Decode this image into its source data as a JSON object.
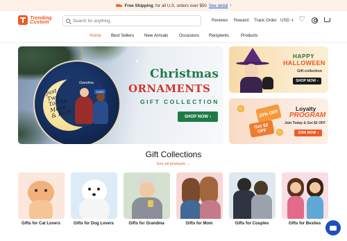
{
  "announcement": {
    "bold": "Free Shipping",
    "text": "for all U.S. orders over $50",
    "link": "See detail",
    "arrow": "›"
  },
  "header": {
    "logo_line1": "Trending",
    "logo_line2": "Custom",
    "search_placeholder": "Search for anything",
    "links": [
      "Reviews",
      "Reward",
      "Track Order"
    ],
    "currency": "USD",
    "currency_caret": "▾"
  },
  "nav": {
    "items": [
      "Home",
      "Best Sellers",
      "New Arrivals",
      "Occasions",
      "Recipients",
      "Products"
    ],
    "active": "Home"
  },
  "hero": {
    "title1": "Christmas",
    "title2": "ORNAMENTS",
    "subtitle": "GIFT COLLECTION",
    "button": "SHOP NOW",
    "button_arrow": "›",
    "ornament_text_line1": "Just",
    "ornament_text_line2": "Two",
    "ornament_text_line3": "To The",
    "ornament_text_line4": "Moon",
    "ornament_text_line5": "& Back",
    "ornament_name1": "Grandma",
    "ornament_name2": "Luna"
  },
  "promo_halloween": {
    "line1": "HAPPY",
    "line2": "HALLOWEEN",
    "sub": "Gift collection",
    "button": "SHOP NOW",
    "button_arrow": "›"
  },
  "promo_loyalty": {
    "line1": "Loyalty",
    "line2": "PROGRAM",
    "sub": "Join Today & Get $2 OFF",
    "button": "JOIN NOW",
    "button_arrow": "›",
    "coupon1": "20% OFF",
    "coupon2": "Get $2 OFF"
  },
  "collections": {
    "title": "Gift Collections",
    "see_all": "See all products",
    "see_all_arrow": "→",
    "items": [
      {
        "label": "Gifts for Cat Lovers"
      },
      {
        "label": "Gifts for Dog Lovers"
      },
      {
        "label": "Gifts for Grandma"
      },
      {
        "label": "Gifts for Mom"
      },
      {
        "label": "Gifts for Couples"
      },
      {
        "label": "Gifts for Besties"
      }
    ]
  },
  "colors": {
    "brand": "#ef5a24",
    "hero_green": "#1f7a48",
    "hero_red": "#d2352d",
    "chat": "#1e4fb8"
  },
  "icons": {
    "shipping": "truck-icon",
    "search": "search-icon",
    "wishlist": "heart-icon",
    "account": "user-icon",
    "cart": "cart-icon",
    "chat": "chat-icon"
  }
}
